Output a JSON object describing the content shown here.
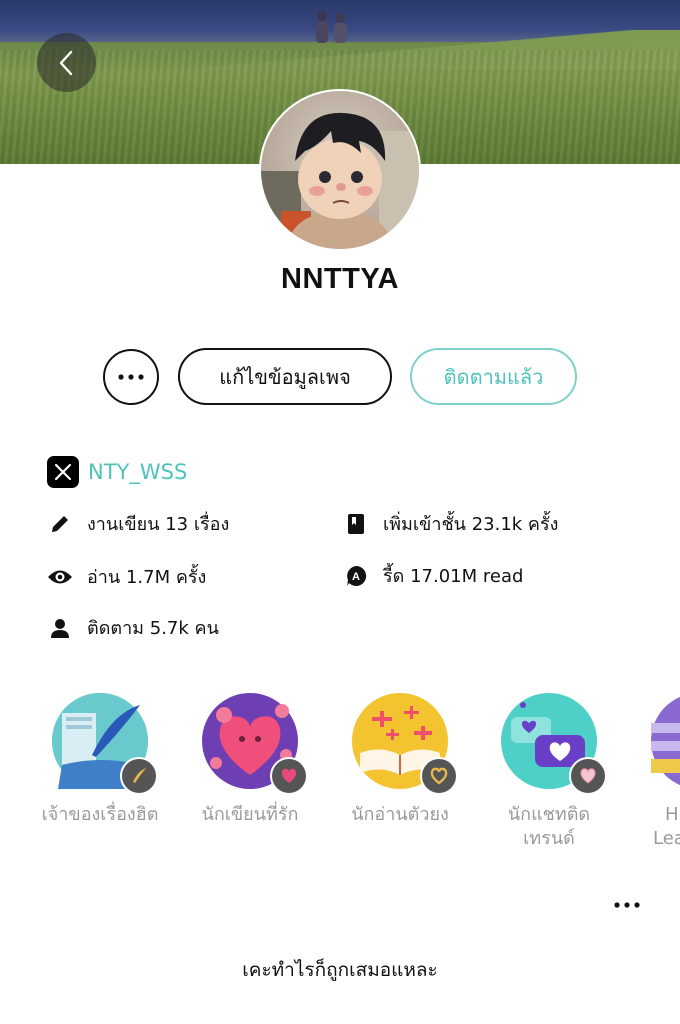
{
  "profile": {
    "username": "NNTTYA",
    "bio": "เคะทำไรก็ถูกเสมอแหละ"
  },
  "actions": {
    "edit_label": "แก้ไขข้อมูลเพจ",
    "follow_label": "ติดตามแล้ว"
  },
  "social": {
    "x_handle": "NTY_WSS"
  },
  "stats": {
    "works": "งานเขียน 13 เรื่อง",
    "library_adds": "เพิ่มเข้าชั้น 23.1k ครั้ง",
    "reads": "อ่าน 1.7M ครั้ง",
    "rid": "รี้ด 17.01M read",
    "followers": "ติดตาม 5.7k คน"
  },
  "badges": [
    {
      "label": "เจ้าของเรื่องฮิต",
      "icon": "quill-icon"
    },
    {
      "label": "นักเขียนที่รัก",
      "icon": "heart-icon"
    },
    {
      "label": "นักอ่านตัวยง",
      "icon": "open-book-icon"
    },
    {
      "label_line1": "นักแชทติด",
      "label_line2": "เทรนด์",
      "icon": "chat-heart-icon"
    },
    {
      "label_line1": "H",
      "label_line2": "Lea",
      "icon": "partial-badge-icon"
    }
  ],
  "colors": {
    "accent": "#4ec3bc",
    "text": "#111111",
    "muted": "#9a9a9a"
  }
}
